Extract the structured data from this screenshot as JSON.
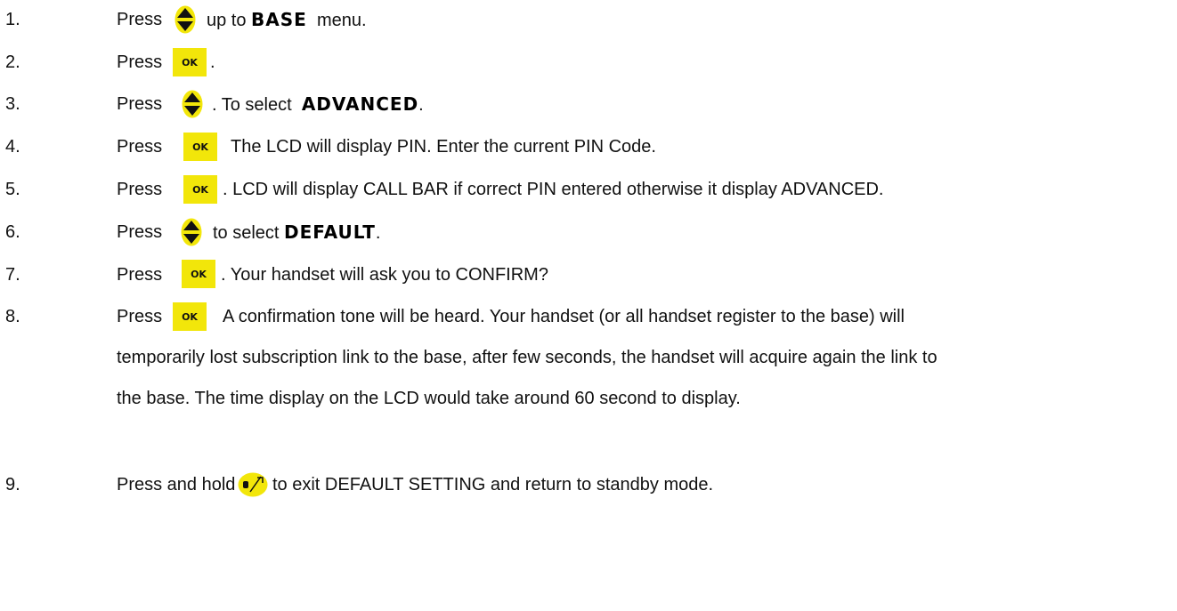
{
  "icon_color": "#f2e60a",
  "ok_text": "OK",
  "steps": [
    {
      "num": "1.",
      "press": "Press",
      "a": "up to",
      "kw": "BASE",
      "b": "menu."
    },
    {
      "num": "2.",
      "press": "Press",
      "a": "."
    },
    {
      "num": "3.",
      "press": "Press",
      "a": ".  To select",
      "kw": "ADVANCED",
      "b": "."
    },
    {
      "num": "4.",
      "press": "Press",
      "a": "The LCD will display PIN.  Enter the current PIN Code."
    },
    {
      "num": "5.",
      "press": "Press",
      "a": ". LCD will display CALL BAR if correct PIN entered otherwise it display ADVANCED."
    },
    {
      "num": "6.",
      "press": "Press",
      "a": "to select",
      "kw": "DEFAULT",
      "b": "."
    },
    {
      "num": "7.",
      "press": "Press",
      "a": ".  Your handset will ask you to CONFIRM?"
    },
    {
      "num": "8.",
      "press": "Press",
      "a": "A confirmation tone will be heard.  Your handset (or all handset register to the base) will",
      "c1": "temporarily lost subscription link to the base, after few seconds, the handset  will acquire again the link to",
      "c2": "the base.  The time display on the LCD would take around 60 second to display."
    },
    {
      "num": "9.",
      "press": "Press and hold",
      "a": "to exit DEFAULT SETTING  and return to standby mode."
    }
  ]
}
